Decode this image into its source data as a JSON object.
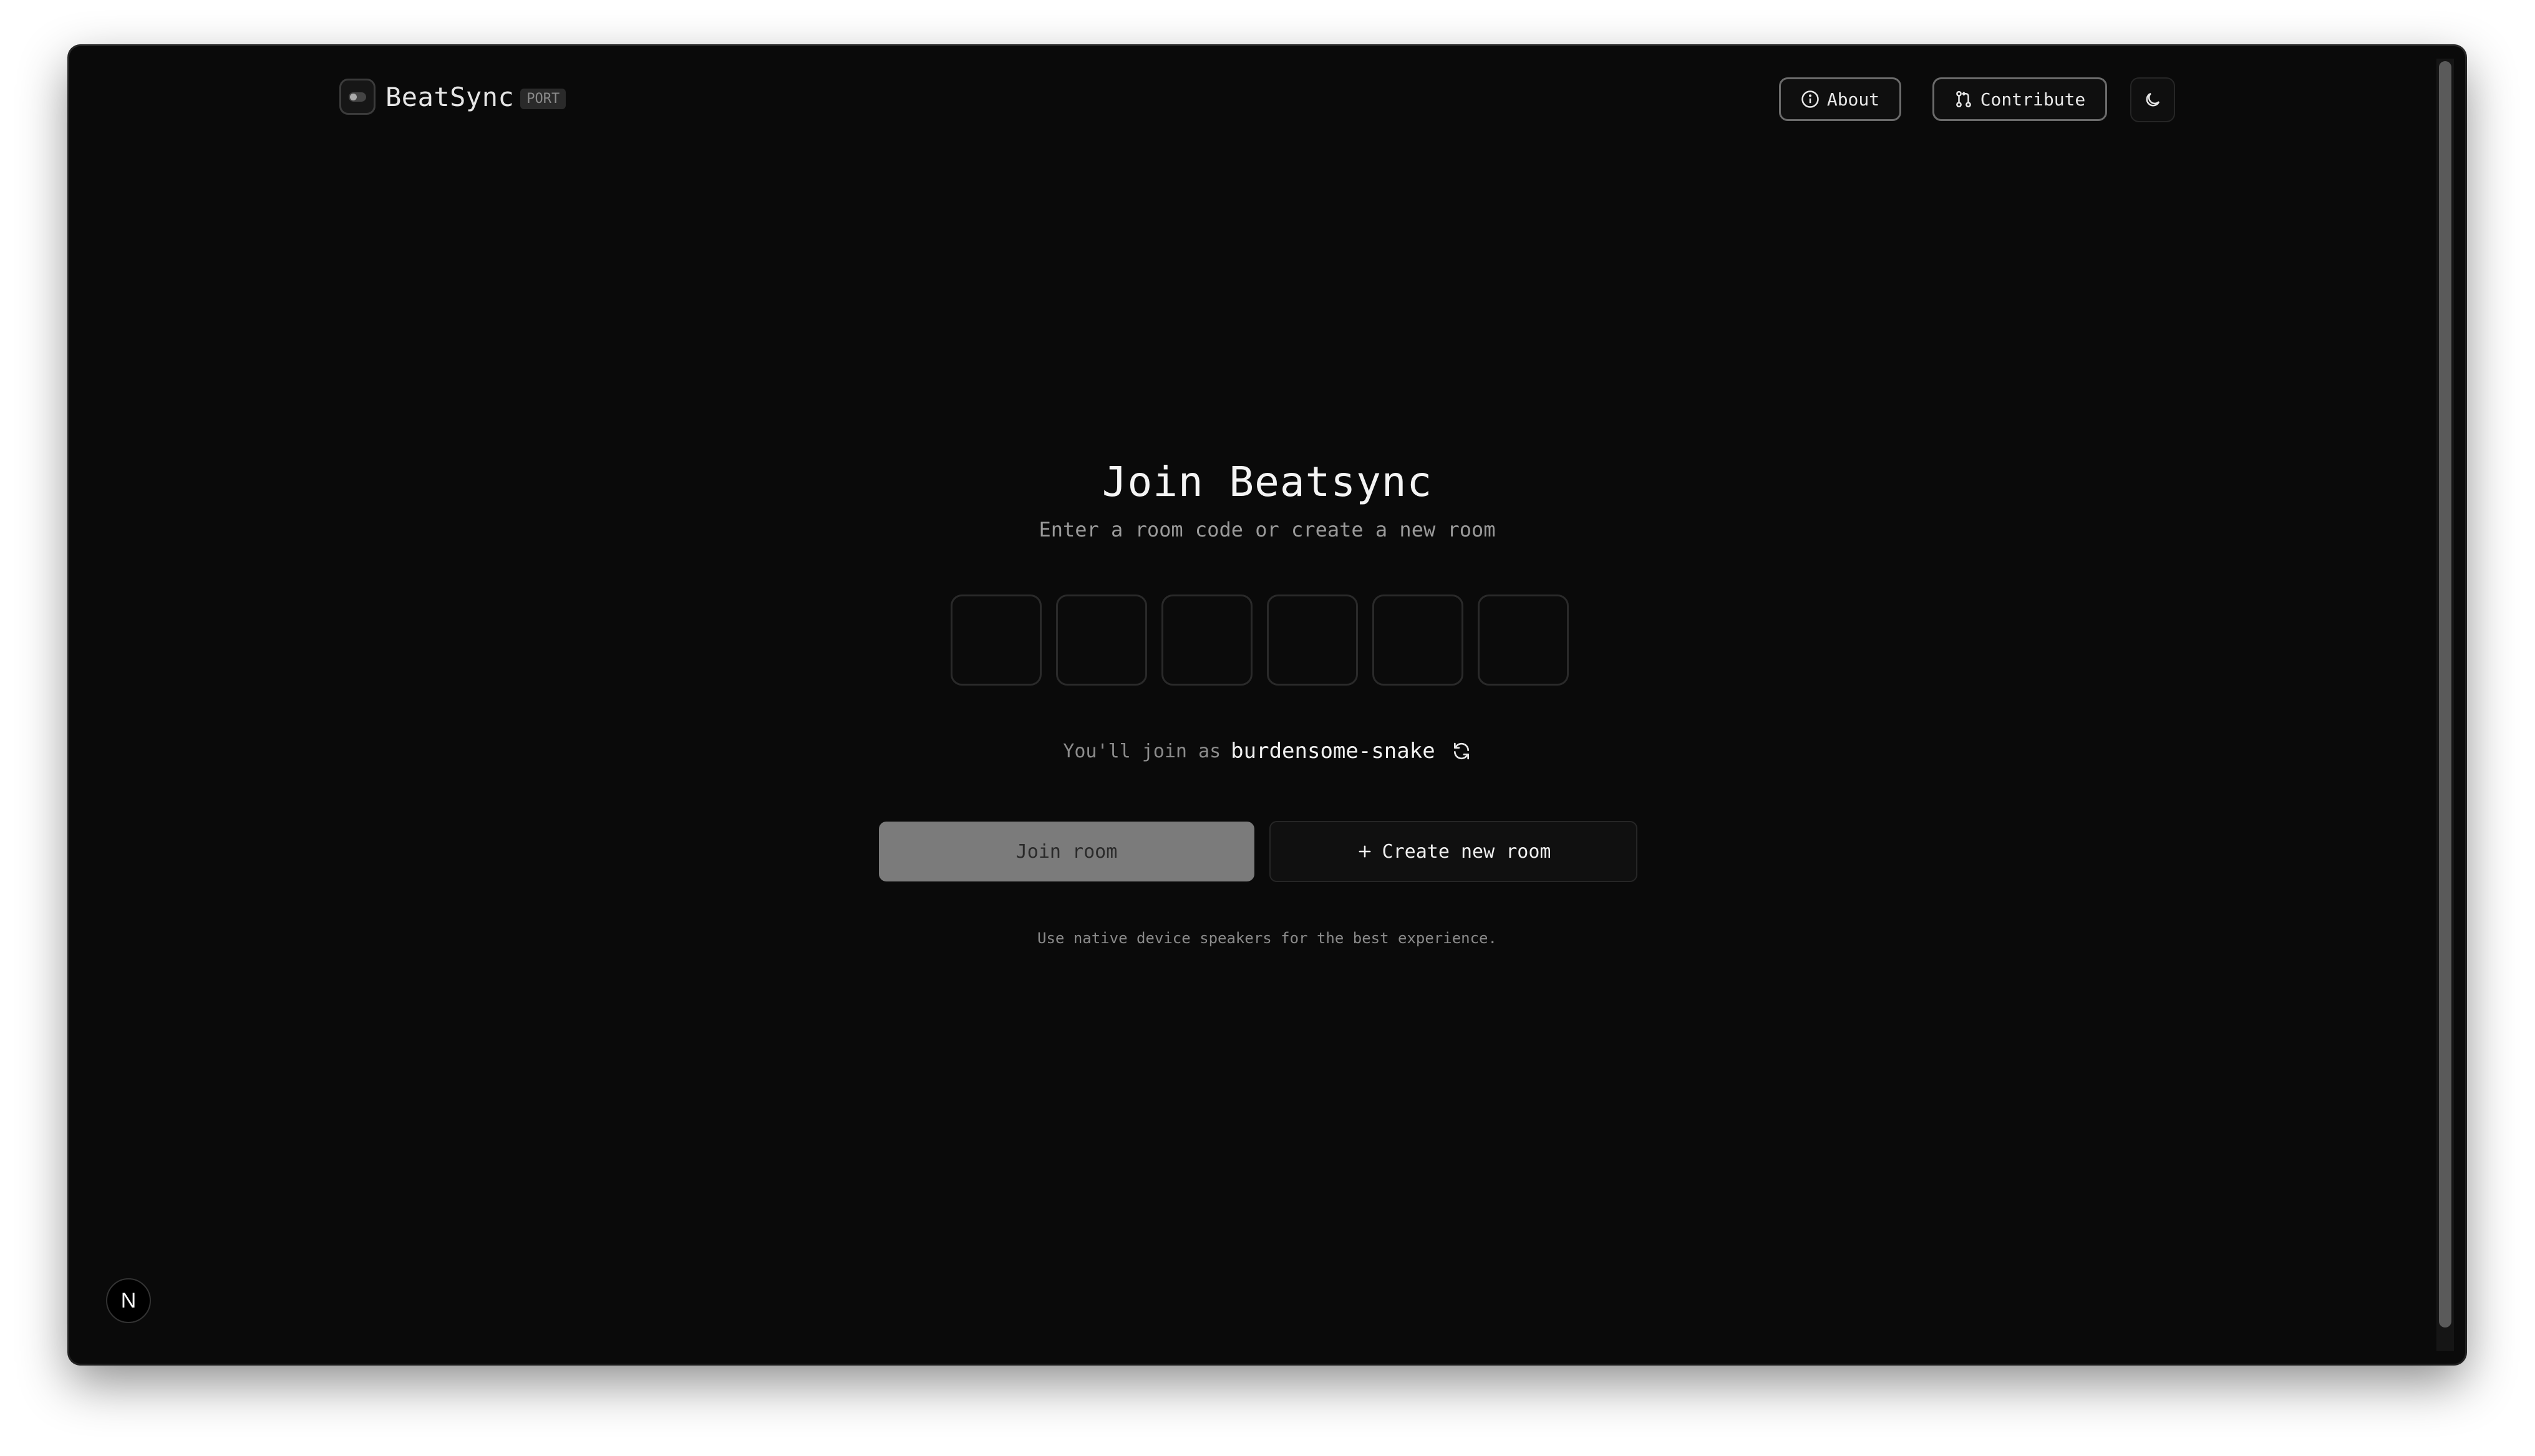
{
  "header": {
    "brand": "BeatSync",
    "badge": "PORT",
    "about_label": "About",
    "contribute_label": "Contribute"
  },
  "main": {
    "title": "Join Beatsync",
    "subtitle": "Enter a room code or create a new room",
    "code_length": 6,
    "join_as_prefix": "You'll join as",
    "username": "burdensome-snake",
    "join_button": "Join room",
    "create_button": "Create new room",
    "footnote": "Use native device speakers for the best experience."
  },
  "corner_badge": "N",
  "icons": {
    "logo": "toggle-icon",
    "about": "info-icon",
    "contribute": "git-pull-request-icon",
    "theme": "moon-icon",
    "refresh": "refresh-icon",
    "create": "plus-icon"
  },
  "colors": {
    "background": "#0a0a0a",
    "join_disabled": "#7b7b7b",
    "text": "#f0f0f0"
  }
}
